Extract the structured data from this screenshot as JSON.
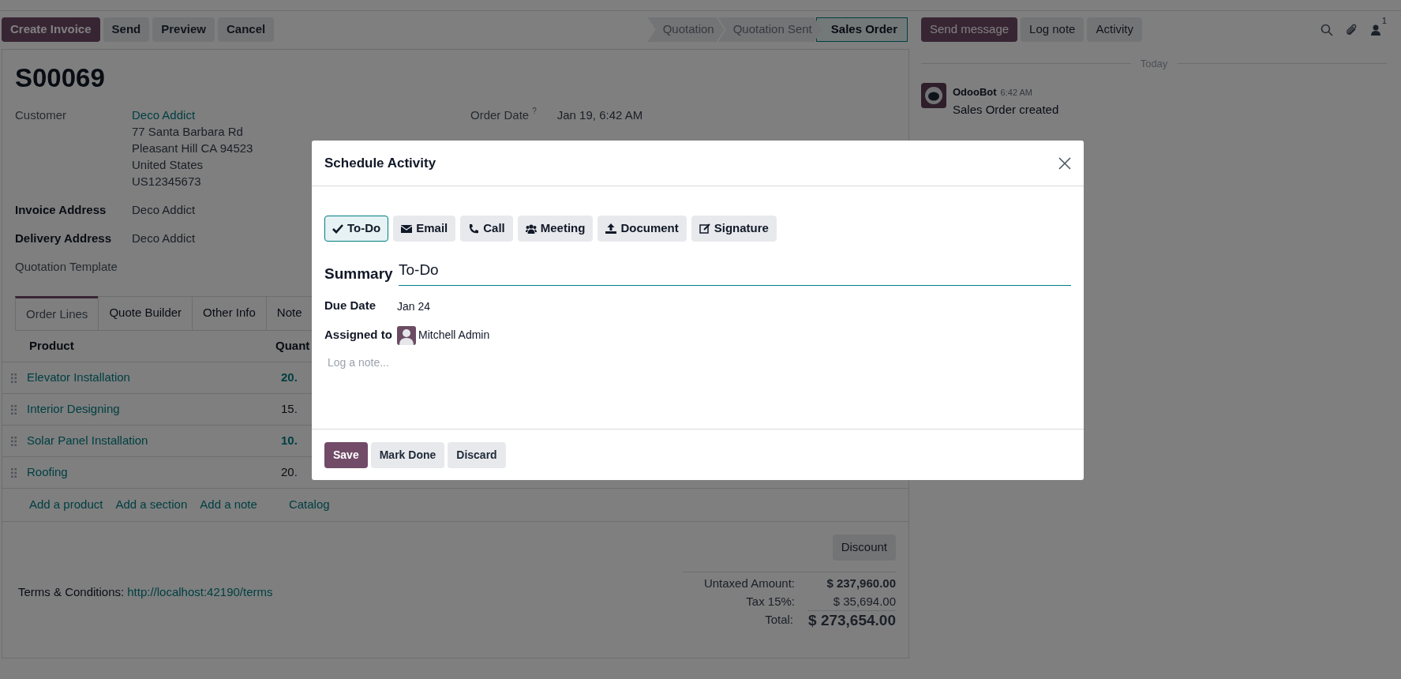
{
  "control_bar": {
    "buttons": [
      {
        "label": "Create Invoice",
        "kind": "primary"
      },
      {
        "label": "Send",
        "kind": "secondary"
      },
      {
        "label": "Preview",
        "kind": "secondary"
      },
      {
        "label": "Cancel",
        "kind": "secondary"
      }
    ]
  },
  "statusbar": [
    {
      "label": "Quotation",
      "selected": false
    },
    {
      "label": "Quotation Sent",
      "selected": false
    },
    {
      "label": "Sales Order",
      "selected": true
    }
  ],
  "form": {
    "title": "S00069",
    "left_fields": [
      {
        "label": "Customer",
        "bold": false,
        "value": "Deco Addict",
        "link": true,
        "address_lines": [
          "77 Santa Barbara Rd",
          "Pleasant Hill CA 94523",
          "United States",
          "US12345673"
        ]
      },
      {
        "label": "Invoice Address",
        "bold": true,
        "value": "Deco Addict",
        "link": false
      },
      {
        "label": "Delivery Address",
        "bold": true,
        "value": "Deco Addict",
        "link": false
      },
      {
        "label": "Quotation Template",
        "bold": false
      }
    ],
    "right_fields": [
      {
        "label": "Order Date",
        "help": "?",
        "value": "Jan 19, 6:42 AM"
      }
    ],
    "tabs": [
      {
        "label": "Order Lines",
        "selected": true
      },
      {
        "label": "Quote Builder",
        "selected": false
      },
      {
        "label": "Other Info",
        "selected": false
      },
      {
        "label": "Note",
        "selected": false
      }
    ],
    "table": {
      "columns": [
        "Product",
        "Quant"
      ],
      "rows": [
        {
          "product": "Elevator Installation",
          "quantity": "20.",
          "qty_link": true
        },
        {
          "product": "Interior Designing",
          "quantity": "15.",
          "qty_link": false
        },
        {
          "product": "Solar Panel Installation",
          "quantity": "10.",
          "qty_link": true
        },
        {
          "product": "Roofing",
          "quantity": "20.",
          "qty_link": false
        }
      ],
      "add_links": [
        "Add a product",
        "Add a section",
        "Add a note",
        "Catalog"
      ]
    },
    "discount_button": "Discount",
    "terms": {
      "label": "Terms & Conditions:",
      "link": "http://localhost:42190/terms"
    },
    "totals": [
      {
        "label": "Untaxed Amount:",
        "value": "$ 237,960.00",
        "kind": "bold"
      },
      {
        "label": "Tax 15%:",
        "value": "$ 35,694.00",
        "kind": "plain"
      },
      {
        "label": "Total:",
        "value": "$ 273,654.00",
        "kind": "total"
      }
    ]
  },
  "chatter": {
    "buttons": [
      {
        "label": "Send message",
        "kind": "primary"
      },
      {
        "label": "Log note",
        "kind": "secondary"
      },
      {
        "label": "Activity",
        "kind": "secondary"
      }
    ],
    "follower_count": "1",
    "divider": "Today",
    "messages": [
      {
        "author": "OdooBot",
        "time": "6:42 AM",
        "body": "Sales Order created"
      }
    ]
  },
  "dialog": {
    "title": "Schedule Activity",
    "activity_types": [
      {
        "label": "To-Do",
        "kind": "todo",
        "selected": true
      },
      {
        "label": "Email",
        "kind": "email",
        "selected": false
      },
      {
        "label": "Call",
        "kind": "call",
        "selected": false
      },
      {
        "label": "Meeting",
        "kind": "meeting",
        "selected": false
      },
      {
        "label": "Document",
        "kind": "document",
        "selected": false
      },
      {
        "label": "Signature",
        "kind": "signature",
        "selected": false
      }
    ],
    "summary_label": "Summary",
    "summary_value": "To-Do",
    "due_date_label": "Due Date",
    "due_date": "Jan 24",
    "assigned_label": "Assigned to",
    "assigned_to": "Mitchell Admin",
    "note_placeholder": "Log a note...",
    "buttons": [
      {
        "label": "Save",
        "kind": "primary"
      },
      {
        "label": "Mark Done",
        "kind": "secondary"
      },
      {
        "label": "Discard",
        "kind": "secondary"
      }
    ]
  }
}
